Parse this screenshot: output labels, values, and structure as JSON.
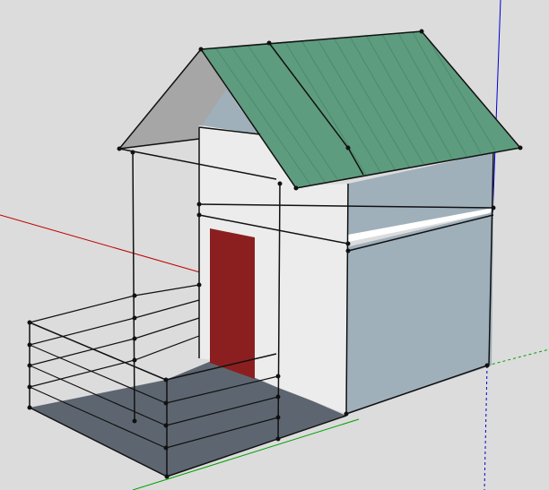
{
  "app": {
    "window_title": "",
    "view": "3d-perspective-model-view"
  },
  "scene": {
    "model": "house-with-porch",
    "background_color": "#dcdcdc",
    "axes": {
      "red_axis_color": "#c00000",
      "green_axis_color": "#00a000",
      "blue_axis_color": "#0000d0"
    },
    "materials": {
      "roof_color": "#5e9c7f",
      "roof_seam_color": "#4c8a6d",
      "wall_light_color": "#ececec",
      "wall_shadow_color": "#9fb0bb",
      "floor_color": "#5d6670",
      "door_color": "#8b1f1f",
      "gable_shadow_color": "#a6a6a6",
      "edge_color": "#111111"
    }
  }
}
